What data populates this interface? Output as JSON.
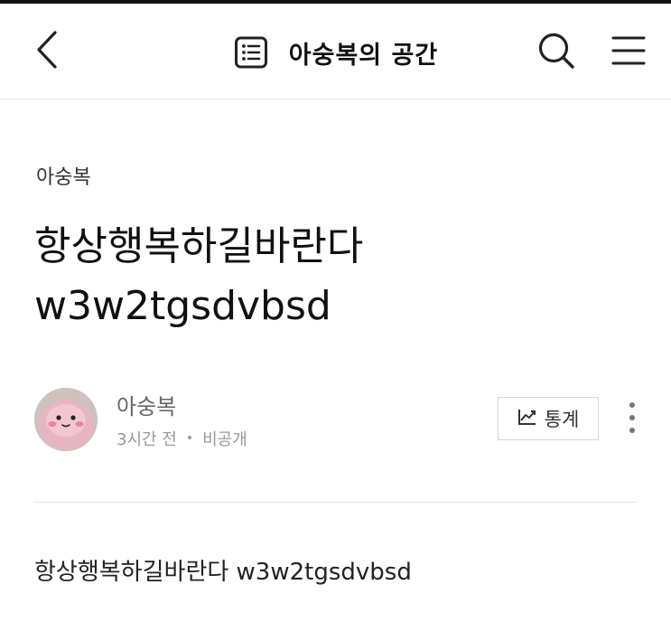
{
  "header": {
    "back_icon": "chevron-left-icon",
    "blog_icon": "list-document-icon",
    "title": "아숭복의 공간",
    "search_icon": "search-icon",
    "menu_icon": "hamburger-menu-icon"
  },
  "post": {
    "category": "아숭복",
    "title": "항상행복하길바란다 w3w2tgsdvbsd",
    "author": {
      "name": "아숭복",
      "time": "3시간 전",
      "separator": "•",
      "visibility": "비공개"
    },
    "stats_label": "통계",
    "stats_icon": "trend-chart-icon",
    "more_icon": "more-vertical-icon",
    "body": "항상행복하길바란다 w3w2tgsdvbsd"
  },
  "colors": {
    "text_primary": "#111111",
    "text_secondary": "#666666",
    "text_muted": "#999999",
    "border": "#d6d6d6"
  }
}
